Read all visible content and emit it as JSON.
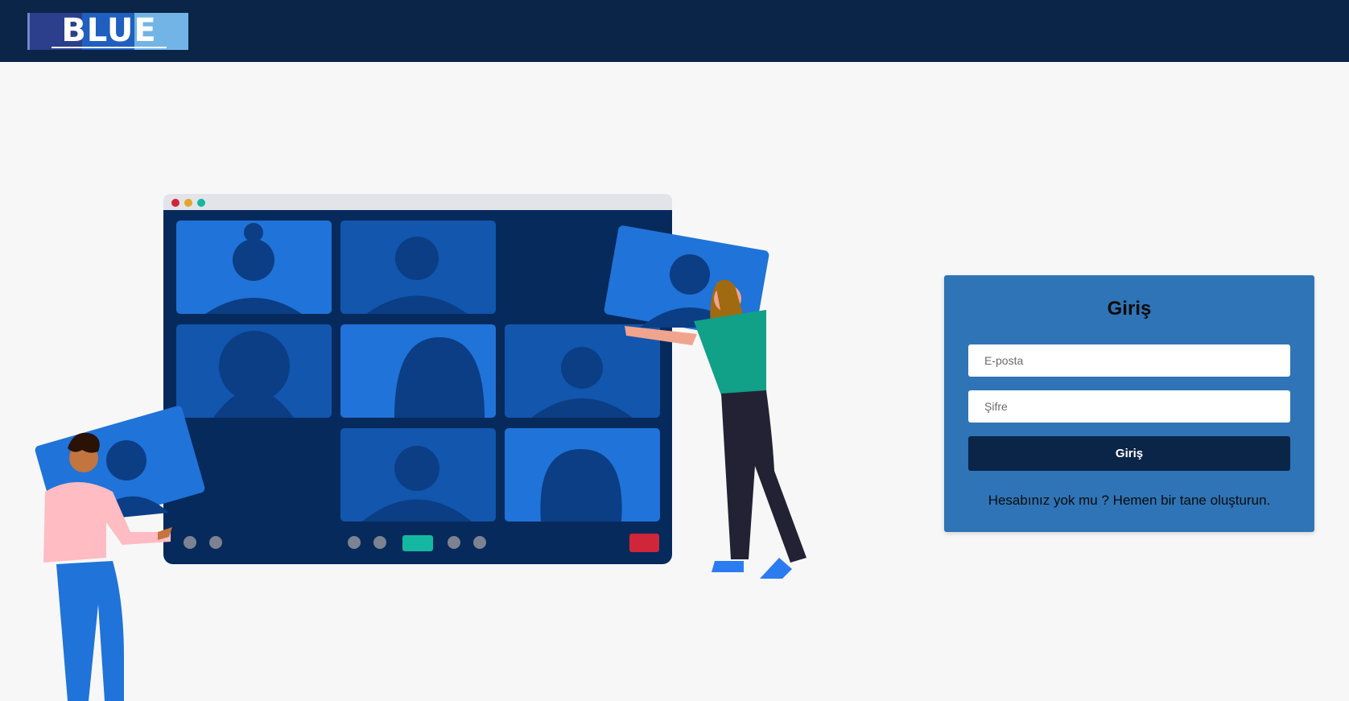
{
  "header": {
    "logo_text": "BLUE"
  },
  "login": {
    "title": "Giriş",
    "email_placeholder": "E-posta",
    "password_placeholder": "Şifre",
    "submit_label": "Giriş",
    "signup_text": "Hesabınız yok mu ? Hemen bir tane oluşturun."
  },
  "colors": {
    "header_bg": "#0a2548",
    "card_bg": "#2e74b6",
    "button_bg": "#0a2548",
    "page_bg": "#f7f7f7"
  }
}
